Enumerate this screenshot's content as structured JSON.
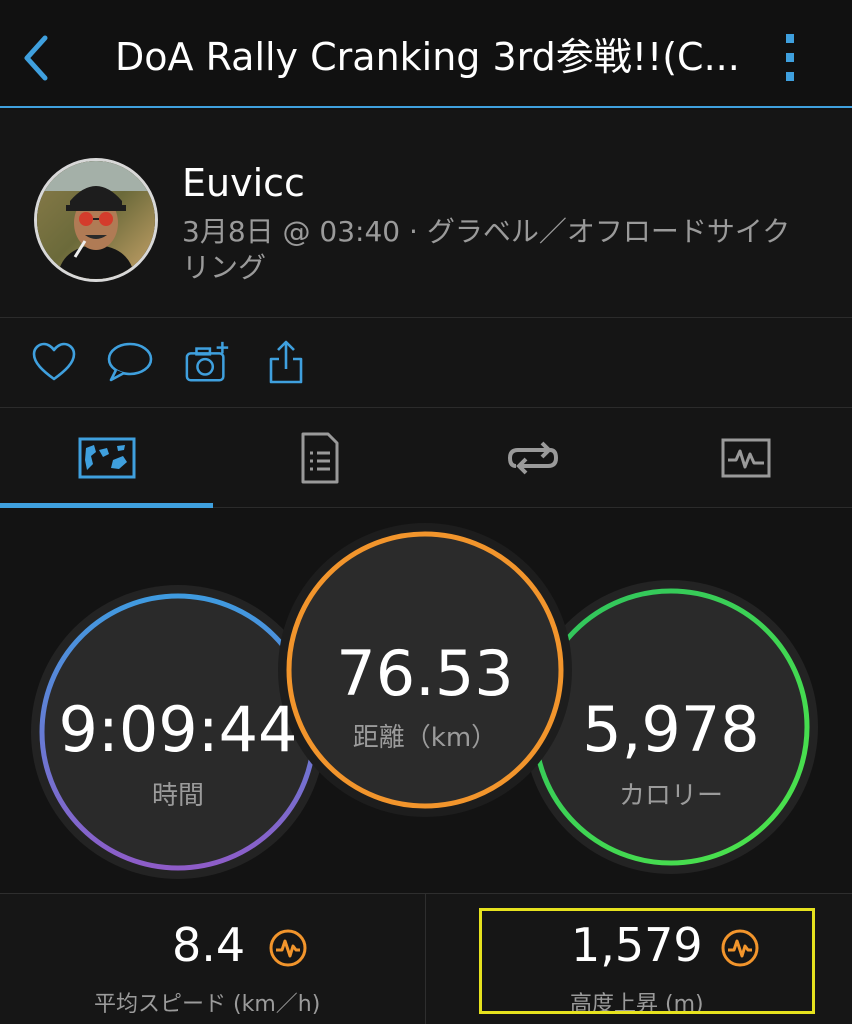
{
  "header": {
    "title": "DoA Rally Cranking 3rd参戦!!(C...",
    "back_icon": "chevron-left-icon",
    "menu_icon": "vertical-dots-icon",
    "accent_color": "#3fa0de"
  },
  "profile": {
    "name": "Euvicc",
    "meta": "3月8日 @ 03:40 · グラベル／オフロードサイクリング"
  },
  "actions": [
    "heart-icon",
    "comment-icon",
    "add-photo-icon",
    "share-icon"
  ],
  "tabs": [
    {
      "name": "overview-map",
      "icon": "map-overview-icon",
      "selected": true
    },
    {
      "name": "details",
      "icon": "document-list-icon",
      "selected": false
    },
    {
      "name": "laps",
      "icon": "loop-icon",
      "selected": false
    },
    {
      "name": "charts",
      "icon": "chart-pulse-icon",
      "selected": false
    }
  ],
  "stats": {
    "time": {
      "value": "9:09:44",
      "label": "時間",
      "colors": [
        "#3f9be0",
        "#8e5cc8"
      ]
    },
    "distance": {
      "value": "76.53",
      "label": "距離（km）",
      "color": "#f2952c"
    },
    "calories": {
      "value": "5,978",
      "label": "カロリー",
      "colors": [
        "#2ec25e",
        "#4ee54a"
      ]
    }
  },
  "bottom": {
    "avg_speed": {
      "value": "8.4",
      "label": "平均スピード (km／h)"
    },
    "elevation_gain": {
      "value": "1,579",
      "label": "高度上昇 (m)"
    },
    "icon": "heart-rate-icon",
    "icon_color": "#f2952c",
    "highlight_color": "#e6e21e"
  }
}
